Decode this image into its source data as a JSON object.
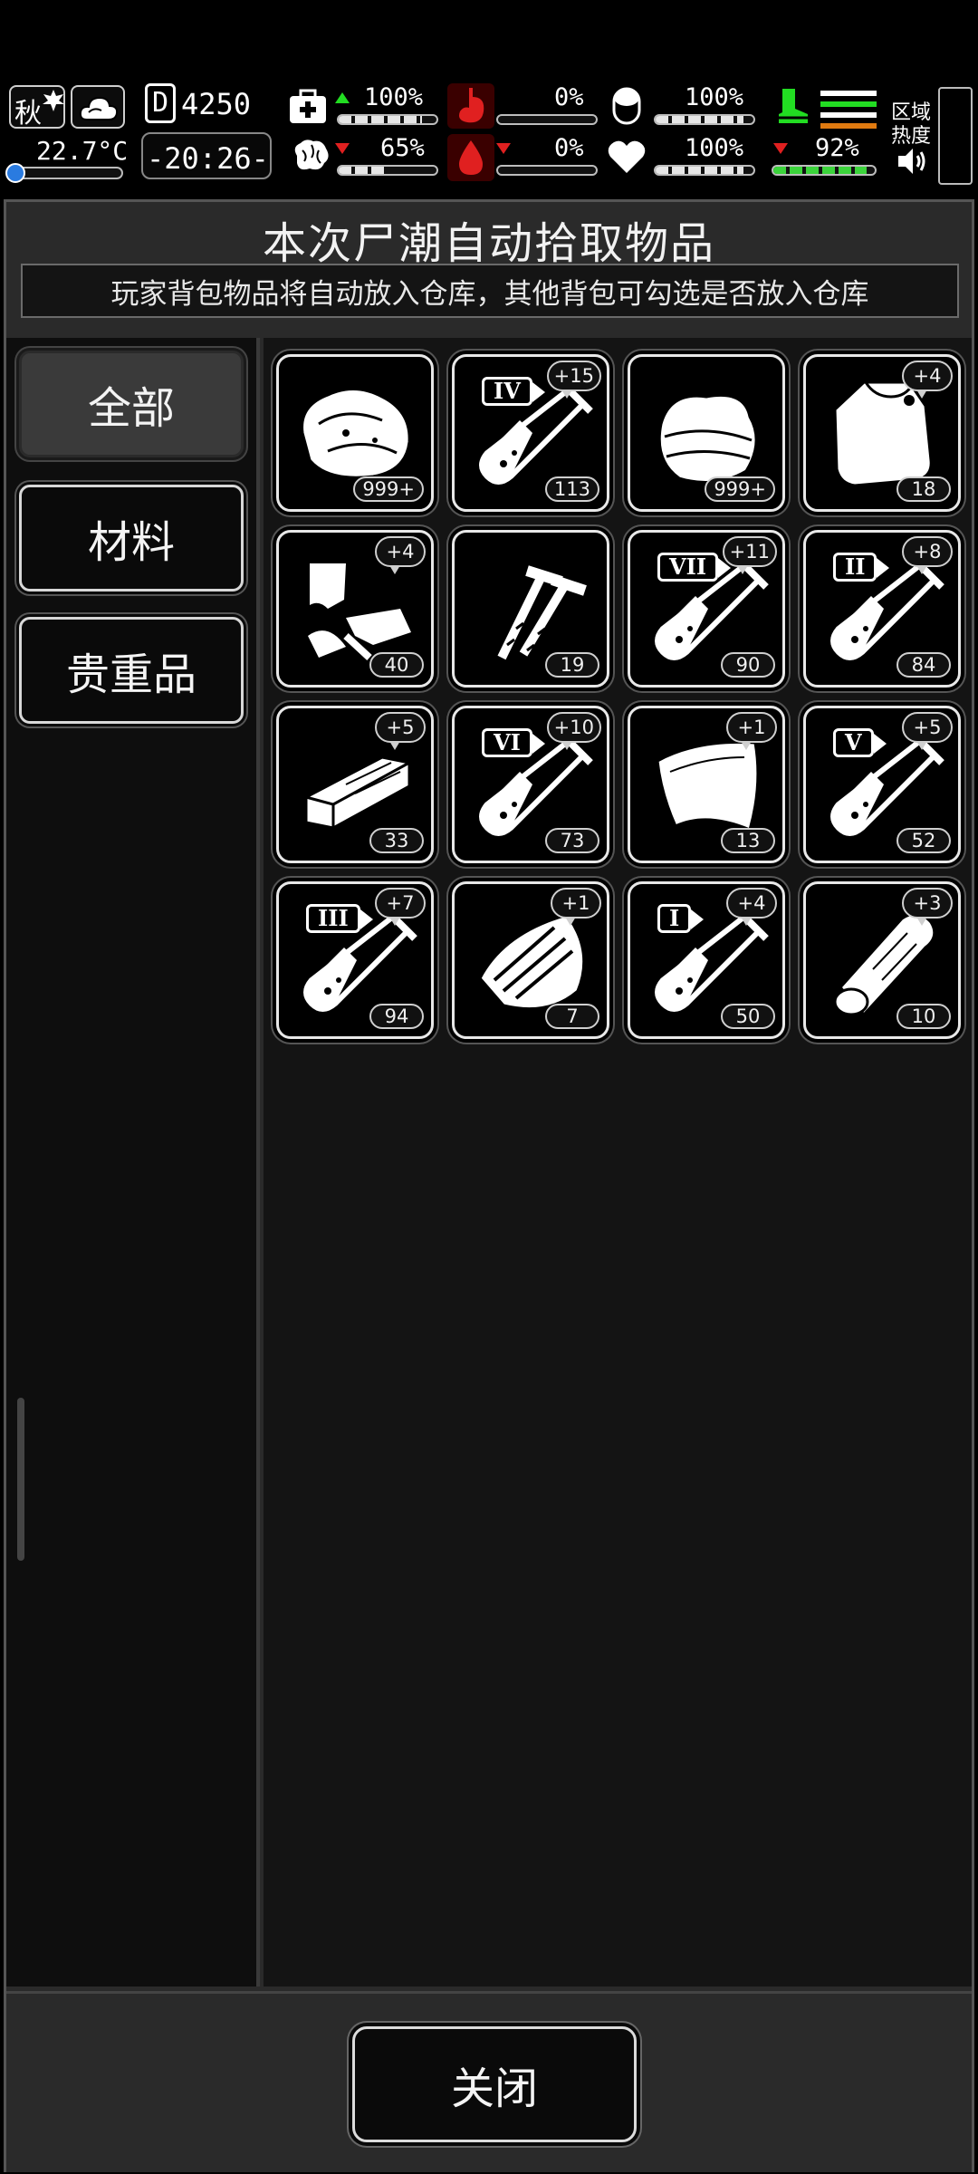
{
  "status": {
    "season": "秋",
    "temperature": "22.7°C",
    "day_counter": "4250",
    "day_prefix": "D",
    "clock": "-20:26-",
    "health": {
      "value": "100%",
      "trend": "up"
    },
    "stomach": {
      "value": "0%"
    },
    "pill": {
      "value": "100%"
    },
    "stamina": {
      "trend": "up"
    },
    "brain": {
      "value": "65%",
      "trend": "down"
    },
    "blood": {
      "value": "0%",
      "trend": "down"
    },
    "heart": {
      "value": "100%"
    },
    "leg": {
      "value": "92%",
      "trend": "down"
    },
    "zone_label": "区域\n热度",
    "zone_label_line1": "区域",
    "zone_label_line2": "热度",
    "levels": {
      "health": 0.85,
      "stomach": 0,
      "pill": 0.9,
      "brain": 0.5,
      "blood": 0,
      "heart": 0.9,
      "leg": 0.92
    }
  },
  "panel": {
    "title": "本次尸潮自动拾取物品",
    "subtitle": "玩家背包物品将自动放入仓库，其他背包可勾选是否放入仓库"
  },
  "sidebar": {
    "tabs": [
      {
        "label": "全部",
        "active": true
      },
      {
        "label": "材料",
        "active": false
      },
      {
        "label": "贵重品",
        "active": false
      }
    ]
  },
  "items": [
    {
      "icon": "raw-meat-icon",
      "count": "999+",
      "bonus": "",
      "roman": ""
    },
    {
      "icon": "test-tube-icon",
      "count": "113",
      "bonus": "+15",
      "roman": "IV"
    },
    {
      "icon": "cloth-icon",
      "count": "999+",
      "bonus": "",
      "roman": ""
    },
    {
      "icon": "plastic-bag-icon",
      "count": "18",
      "bonus": "+4",
      "roman": ""
    },
    {
      "icon": "scrap-parts-icon",
      "count": "40",
      "bonus": "+4",
      "roman": ""
    },
    {
      "icon": "nails-icon",
      "count": "19",
      "bonus": "",
      "roman": ""
    },
    {
      "icon": "test-tube-icon",
      "count": "90",
      "bonus": "+11",
      "roman": "VII"
    },
    {
      "icon": "test-tube-icon",
      "count": "84",
      "bonus": "+8",
      "roman": "II"
    },
    {
      "icon": "wood-plank-icon",
      "count": "33",
      "bonus": "+5",
      "roman": ""
    },
    {
      "icon": "test-tube-icon",
      "count": "73",
      "bonus": "+10",
      "roman": "VI"
    },
    {
      "icon": "leather-sheet-icon",
      "count": "13",
      "bonus": "+1",
      "roman": ""
    },
    {
      "icon": "test-tube-icon",
      "count": "52",
      "bonus": "+5",
      "roman": "V"
    },
    {
      "icon": "test-tube-icon",
      "count": "94",
      "bonus": "+7",
      "roman": "III"
    },
    {
      "icon": "bark-shield-icon",
      "count": "7",
      "bonus": "+1",
      "roman": ""
    },
    {
      "icon": "test-tube-icon",
      "count": "50",
      "bonus": "+4",
      "roman": "I"
    },
    {
      "icon": "log-icon",
      "count": "10",
      "bonus": "+3",
      "roman": ""
    }
  ],
  "footer": {
    "close_label": "关闭"
  },
  "colors": {
    "accent_green": "#22dd22",
    "alert_red": "#e02020",
    "panel_bg": "#2a2a2a"
  }
}
